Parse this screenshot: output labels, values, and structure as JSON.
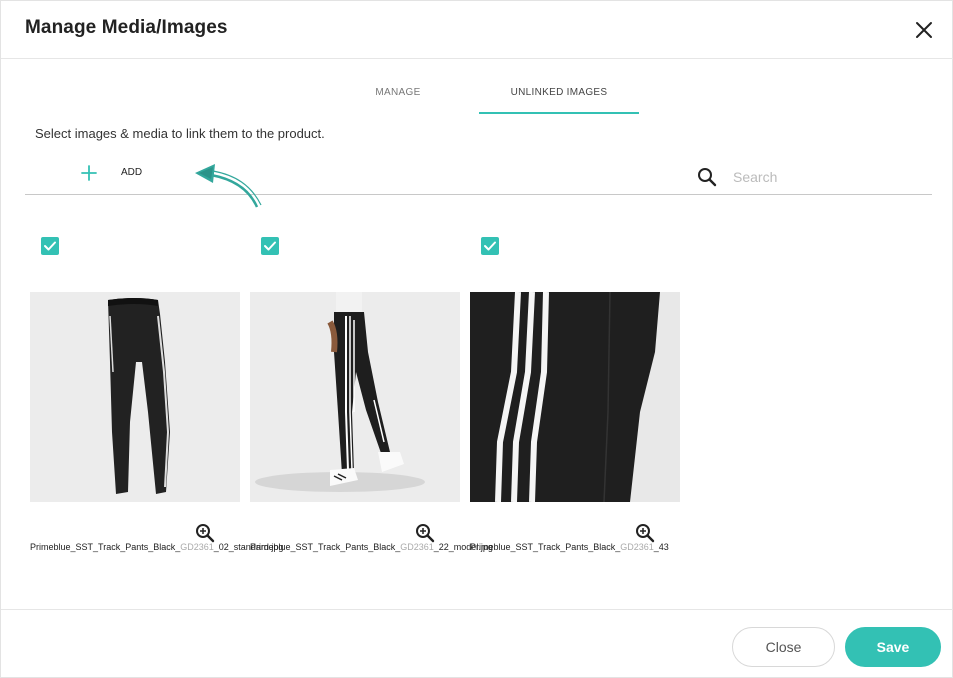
{
  "dialog": {
    "title": "Manage Media/Images"
  },
  "tabs": [
    {
      "label": "MANAGE",
      "active": false
    },
    {
      "label": "UNLINKED IMAGES",
      "active": true
    }
  ],
  "instructions": "Select images & media to link them to the product.",
  "toolbar": {
    "add_label": "ADD",
    "search_placeholder": "Search"
  },
  "images": [
    {
      "checked": true,
      "name_prefix": "Primeblue_SST_Track_Pants_Black_",
      "name_muted": "GD2361",
      "name_suffix": "_02_standard.jpg"
    },
    {
      "checked": true,
      "name_prefix": "Primeblue_SST_Track_Pants_Black_",
      "name_muted": "GD2361",
      "name_suffix": "_22_model.jpg"
    },
    {
      "checked": true,
      "name_prefix": "Primeblue_SST_Track_Pants_Black_",
      "name_muted": "GD2361",
      "name_suffix": "_43"
    }
  ],
  "footer": {
    "close_label": "Close",
    "save_label": "Save"
  },
  "colors": {
    "accent": "#33c1b4"
  }
}
